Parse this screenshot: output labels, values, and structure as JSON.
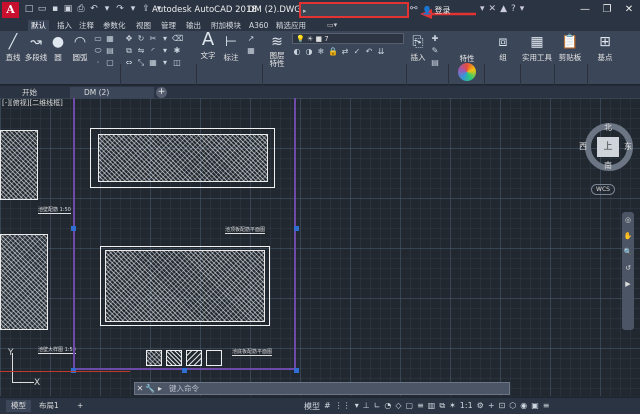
{
  "window": {
    "logo": "A",
    "app_title": "Autodesk AutoCAD 2018",
    "file_title": "DM (2).DWG",
    "login_label": "登录"
  },
  "ribbon_tabs": [
    "默认",
    "插入",
    "注释",
    "参数化",
    "视图",
    "管理",
    "输出",
    "附加模块",
    "A360",
    "精选应用"
  ],
  "ribbon": {
    "draw": {
      "line": "直线",
      "polyline": "多段线",
      "circle": "圆",
      "arc": "圆弧",
      "panel": "绘图"
    },
    "modify": {
      "panel": "修改"
    },
    "annotation": {
      "text": "文字",
      "dimension": "标注",
      "panel": "注释"
    },
    "layers": {
      "layer_props": "图层\n特性",
      "layer_value": "7",
      "panel": "图层"
    },
    "block": {
      "insert": "插入",
      "panel": "块"
    },
    "properties": {
      "label": "特性"
    },
    "groups": {
      "label": "组"
    },
    "utilities": {
      "label": "实用工具"
    },
    "clipboard": {
      "label": "剪贴板"
    },
    "base": {
      "label": "基点"
    },
    "view_panel": "视图"
  },
  "file_tabs": {
    "start": "开始",
    "drawing": "DM (2)"
  },
  "canvas": {
    "view_label": "[-][俯视][二维线框]",
    "captions": [
      "池顶板配筋平面图",
      "池底板配筋平面图",
      "剖面图",
      "池壁配筋 1:50",
      "池壁大样图 1:50",
      "集水坑大样图"
    ]
  },
  "viewcube": {
    "north": "北",
    "south": "南",
    "east": "东",
    "west": "西",
    "face": "上",
    "wcs": "WCS"
  },
  "command": {
    "placeholder": "键入命令"
  },
  "status": {
    "model_tab": "模型",
    "layout_tab": "布局1",
    "model_label": "模型",
    "scale": "1:1"
  },
  "colors": {
    "accent_red": "#e23232",
    "layout_border": "#6d4aa8",
    "handle_blue": "#2f6fd4"
  }
}
